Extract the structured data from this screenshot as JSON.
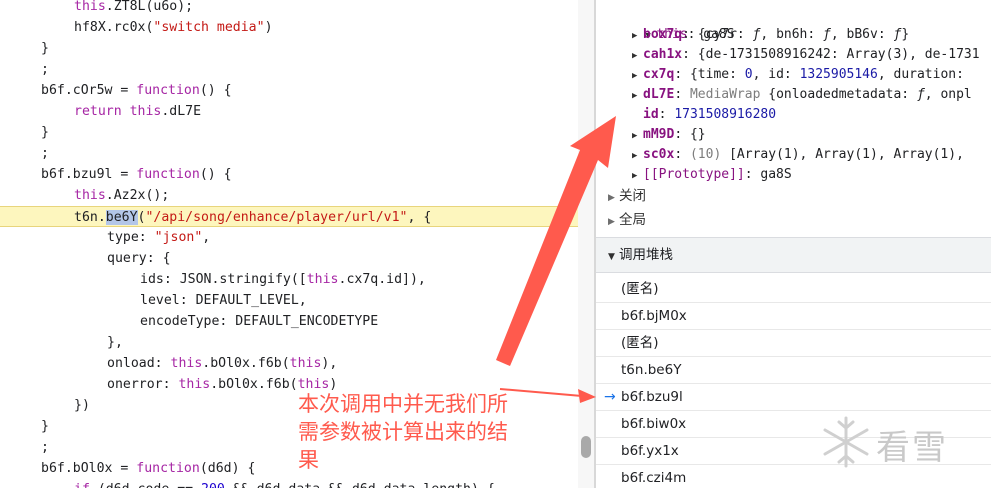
{
  "editor": {
    "lines": [
      {
        "ind": 4,
        "parts": [
          [
            "kw",
            "this"
          ],
          [
            "plain",
            ".ZT8L(u6o);"
          ]
        ]
      },
      {
        "ind": 4,
        "parts": [
          [
            "plain",
            "hf8X.rc0x("
          ],
          [
            "str",
            "\"switch media\""
          ],
          [
            "plain",
            ")"
          ]
        ]
      },
      {
        "ind": 0,
        "parts": [
          [
            "plain",
            "}"
          ]
        ]
      },
      {
        "ind": 0,
        "parts": [
          [
            "plain",
            ";"
          ]
        ]
      },
      {
        "ind": 0,
        "parts": [
          [
            "plain",
            "b6f.cOr5w = "
          ],
          [
            "kw",
            "function"
          ],
          [
            "plain",
            "() {"
          ]
        ]
      },
      {
        "ind": 4,
        "parts": [
          [
            "kw",
            "return"
          ],
          [
            "plain",
            " "
          ],
          [
            "kw",
            "this"
          ],
          [
            "plain",
            ".dL7E"
          ]
        ]
      },
      {
        "ind": 0,
        "parts": [
          [
            "plain",
            "}"
          ]
        ]
      },
      {
        "ind": 0,
        "parts": [
          [
            "plain",
            ";"
          ]
        ]
      },
      {
        "ind": 0,
        "parts": [
          [
            "plain",
            "b6f.bzu9l = "
          ],
          [
            "kw",
            "function"
          ],
          [
            "plain",
            "() {"
          ]
        ]
      },
      {
        "ind": 4,
        "parts": [
          [
            "kw",
            "this"
          ],
          [
            "plain",
            ".Az2x();"
          ]
        ]
      },
      {
        "ind": 4,
        "highlight": true,
        "parts": [
          [
            "plain",
            "t6n."
          ],
          [
            "sel",
            "be6Y"
          ],
          [
            "plain",
            "("
          ],
          [
            "str",
            "\"/api/song/enhance/player/url/v1\""
          ],
          [
            "plain",
            ", {"
          ]
        ]
      },
      {
        "ind": 8,
        "parts": [
          [
            "plain",
            "type: "
          ],
          [
            "str",
            "\"json\""
          ],
          [
            "plain",
            ","
          ]
        ]
      },
      {
        "ind": 8,
        "parts": [
          [
            "plain",
            "query: {"
          ]
        ]
      },
      {
        "ind": 12,
        "parts": [
          [
            "plain",
            "ids: JSON.stringify(["
          ],
          [
            "kw",
            "this"
          ],
          [
            "plain",
            ".cx7q.id]),"
          ]
        ]
      },
      {
        "ind": 12,
        "parts": [
          [
            "plain",
            "level: DEFAULT_LEVEL,"
          ]
        ]
      },
      {
        "ind": 12,
        "parts": [
          [
            "plain",
            "encodeType: DEFAULT_ENCODETYPE"
          ]
        ]
      },
      {
        "ind": 8,
        "parts": [
          [
            "plain",
            "},"
          ]
        ]
      },
      {
        "ind": 8,
        "parts": [
          [
            "plain",
            "onload: "
          ],
          [
            "kw",
            "this"
          ],
          [
            "plain",
            ".bOl0x.f6b("
          ],
          [
            "kw",
            "this"
          ],
          [
            "plain",
            "),"
          ]
        ]
      },
      {
        "ind": 8,
        "parts": [
          [
            "plain",
            "onerror: "
          ],
          [
            "kw",
            "this"
          ],
          [
            "plain",
            ".bOl0x.f6b("
          ],
          [
            "kw",
            "this"
          ],
          [
            "plain",
            ")"
          ]
        ]
      },
      {
        "ind": 4,
        "parts": [
          [
            "plain",
            "})"
          ]
        ]
      },
      {
        "ind": 0,
        "parts": [
          [
            "plain",
            "}"
          ]
        ]
      },
      {
        "ind": 0,
        "parts": [
          [
            "plain",
            ";"
          ]
        ]
      },
      {
        "ind": 0,
        "parts": [
          [
            "plain",
            "b6f.bOl0x = "
          ],
          [
            "kw",
            "function"
          ],
          [
            "plain",
            "(d6d) {"
          ]
        ]
      },
      {
        "ind": 4,
        "parts": [
          [
            "kw",
            "if"
          ],
          [
            "plain",
            " (d6d.code == "
          ],
          [
            "num",
            "200"
          ],
          [
            "plain",
            " && d6d.data && d6d.data.length) {"
          ]
        ]
      }
    ]
  },
  "scope": {
    "this_key": "this",
    "this_val": "ga8S",
    "rows": [
      {
        "key": "box7q",
        "val_parts": [
          [
            "plain",
            "{cy7r: "
          ],
          [
            "fn",
            "ƒ"
          ],
          [
            "plain",
            ", bn6h: "
          ],
          [
            "fn",
            "ƒ"
          ],
          [
            "plain",
            ", bB6v: "
          ],
          [
            "fn",
            "ƒ"
          ],
          [
            "plain",
            "}"
          ]
        ],
        "arrow": true
      },
      {
        "key": "cah1x",
        "val_parts": [
          [
            "plain",
            "{de-1731508916242: Array(3), de-1731"
          ]
        ],
        "arrow": true
      },
      {
        "key": "cx7q",
        "val_parts": [
          [
            "plain",
            "{time: "
          ],
          [
            "num",
            "0"
          ],
          [
            "plain",
            ", id: "
          ],
          [
            "num",
            "1325905146"
          ],
          [
            "plain",
            ", duration: "
          ]
        ],
        "arrow": true
      },
      {
        "key": "dL7E",
        "val_parts": [
          [
            "dim",
            "MediaWrap "
          ],
          [
            "plain",
            "{onloadedmetadata: "
          ],
          [
            "fn",
            "ƒ"
          ],
          [
            "plain",
            ", onpl"
          ]
        ],
        "arrow": true
      },
      {
        "key": "id",
        "val_parts": [
          [
            "num",
            "1731508916280"
          ]
        ],
        "arrow": false
      },
      {
        "key": "mM9D",
        "val_parts": [
          [
            "plain",
            "{}"
          ]
        ],
        "arrow": true
      },
      {
        "key": "sc0x",
        "val_parts": [
          [
            "dim",
            "(10) "
          ],
          [
            "plain",
            "[Array(1), Array(1), Array(1), "
          ]
        ],
        "arrow": true
      },
      {
        "key": "[[Prototype]]",
        "val_parts": [
          [
            "plain",
            "ga8S"
          ]
        ],
        "arrow": true,
        "proto": true
      }
    ]
  },
  "sections": {
    "closure": "关闭",
    "global": "全局",
    "callstack": "调用堆栈"
  },
  "callstack": {
    "frames": [
      "(匿名)",
      "b6f.bjM0x",
      "(匿名)",
      "t6n.be6Y",
      "b6f.bzu9l",
      "b6f.biw0x",
      "b6f.yx1x",
      "b6f.czi4m"
    ],
    "current_index": 4
  },
  "annotation": {
    "text": "本次调用中并无我们所需参数被计算出来的结果",
    "color": "#ff5a4d"
  },
  "watermark": {
    "text": "看雪"
  },
  "colors": {
    "highlight": "#fdf6be",
    "selection": "#b3c6e8",
    "accent": "#1a73e8"
  }
}
